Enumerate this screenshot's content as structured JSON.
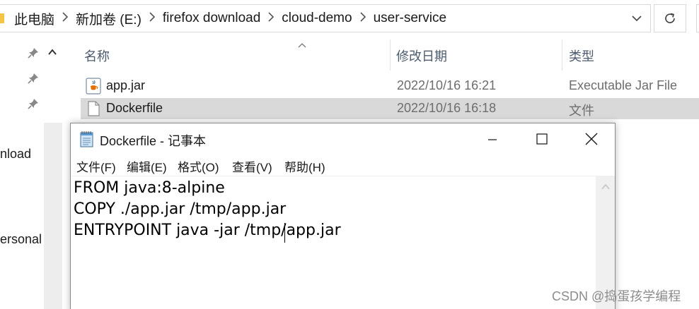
{
  "explorer": {
    "breadcrumbs": [
      "此电脑",
      "新加卷 (E:)",
      "firefox download",
      "cloud-demo",
      "user-service"
    ],
    "icons": {
      "separator": "chevron-right-icon",
      "dropdown": "chevron-down-icon",
      "refresh": "refresh-icon",
      "pin": "pin-icon",
      "scroll_up": "scroll-up-icon",
      "sort": "sort-asc-icon"
    },
    "nav_pane": {
      "items": [
        "nload",
        "ersonal"
      ]
    },
    "columns": {
      "name": "名称",
      "date": "修改日期",
      "type": "类型"
    },
    "files": [
      {
        "name": "app.jar",
        "date": "2022/10/16 16:21",
        "type": "Executable Jar File",
        "icon": "java-jar-icon",
        "selected": false
      },
      {
        "name": "Dockerfile",
        "date": "2022/10/16 16:18",
        "type": "文件",
        "icon": "file-icon",
        "selected": true
      }
    ]
  },
  "notepad": {
    "title": "Dockerfile - 记事本",
    "icon": "notepad-icon",
    "window_buttons": [
      "minimize-icon",
      "maximize-icon",
      "close-icon"
    ],
    "menu": [
      "文件(F)",
      "编辑(E)",
      "格式(O)",
      "查看(V)",
      "帮助(H)"
    ],
    "content_lines": [
      "FROM java:8-alpine",
      "COPY ./app.jar /tmp/app.jar",
      "ENTRYPOINT java -jar /tmp/app.jar"
    ]
  },
  "watermark": "CSDN @捣蛋孩学编程",
  "colors": {
    "selection": "#d9d9d9",
    "header_text": "#4d5b6e",
    "meta_text": "#6d6d6d",
    "folder": "#f4c542"
  }
}
